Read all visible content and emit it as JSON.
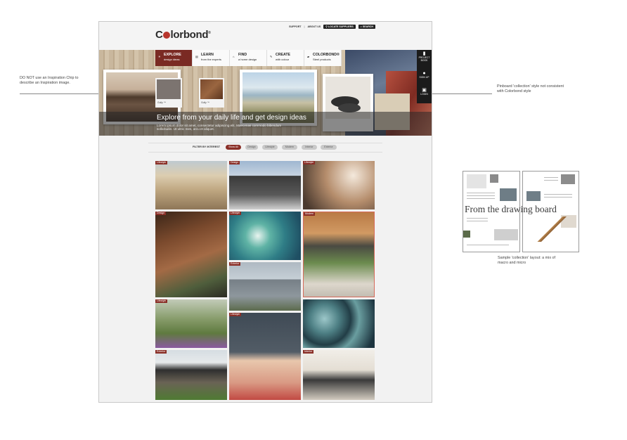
{
  "annotations": {
    "left_note": "DO NOT use an Inspiration Chip to describe an Inspiration image.",
    "right_note": "Pinboard 'collection' style not consistent with Colorbond style",
    "sample_caption": "Sample 'collection' layout: a mix of macro and micro"
  },
  "site": {
    "logo": "Colorbond",
    "top_links": [
      "SUPPORT",
      "ABOUT US"
    ],
    "locate_button": "LOCATE SUPPLIERS",
    "search_button": "SEARCH",
    "nav": [
      {
        "title": "EXPLORE",
        "sub": "design ideas"
      },
      {
        "title": "LEARN",
        "sub": "from the experts"
      },
      {
        "title": "FIND",
        "sub": "a home design"
      },
      {
        "title": "CREATE",
        "sub": "with colour"
      },
      {
        "title": "COLORBOND®",
        "sub": "Steel products"
      }
    ],
    "side_panel": [
      {
        "icon": "book-icon",
        "label": "PROJECT BOOK"
      },
      {
        "icon": "user-icon",
        "label": "SIGN UP"
      },
      {
        "icon": "lock-icon",
        "label": "LOGIN"
      }
    ],
    "chips": [
      "Gully ™",
      "Gully ™"
    ],
    "hero_title": "Explore from your daily life and get design ideas",
    "hero_text": "Lorem ipsum dolor sit amet, consectetur adipiscing elit. Maecenas commodo bibendum sollicitudin. Ut ultric mes, arcu et aliquet.",
    "filter": {
      "label": "FILTER BY INTEREST",
      "options": [
        "Show All",
        "Design",
        "Lifestyle",
        "Modern",
        "Interior",
        "Exterior"
      ],
      "selected": "Show All"
    },
    "tiles": [
      {
        "tag": "Lifestyle"
      },
      {
        "tag": "Design"
      },
      {
        "tag": "Lifestyle"
      },
      {
        "tag": "Design"
      },
      {
        "tag": "Lifestyle"
      },
      {
        "tag": "Modern"
      },
      {
        "tag": "Exterior"
      },
      {
        "tag": "Lifestyle"
      },
      {
        "tag": "Lifestyle"
      },
      {
        "tag": "Exterior"
      },
      {
        "tag": "Interior"
      }
    ]
  },
  "sample": {
    "headline": "From the drawing board"
  },
  "colors": {
    "brand": "#8a2f27",
    "dark": "#1b1b1b",
    "page_bg": "#f2f2f2"
  }
}
